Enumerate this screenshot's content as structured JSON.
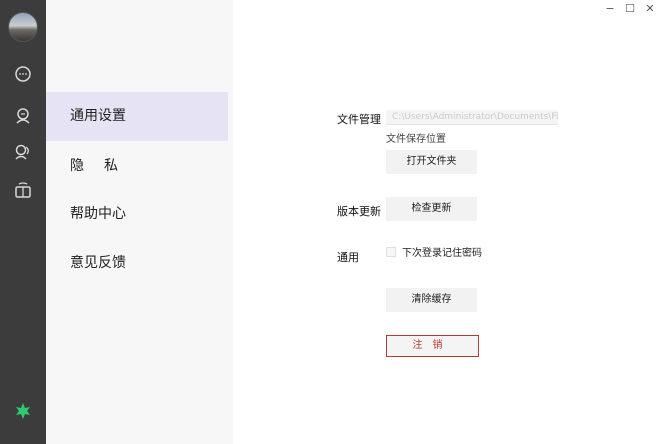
{
  "window": {
    "minimize_label": "−",
    "maximize_label": "☐",
    "close_label": "✕"
  },
  "rail": {
    "icons": [
      "chat-icon",
      "contacts-icon",
      "groups-icon",
      "discover-icon"
    ],
    "bottom_icon": "leaf-icon",
    "accent_color": "#2ecc71"
  },
  "settings_nav": {
    "items": [
      {
        "label": "通用设置",
        "active": true
      },
      {
        "label": "隐私",
        "active": false
      },
      {
        "label": "帮助中心",
        "active": false
      },
      {
        "label": "意见反馈",
        "active": false
      }
    ],
    "active_color": "#e6e4f4"
  },
  "file_management": {
    "label": "文件管理",
    "path_value": "C:\\Users\\Administrator\\Documents\\Files",
    "hint": "文件保存位置",
    "open_folder_button": "打开文件夹"
  },
  "version": {
    "label": "版本更新",
    "check_button": "检查更新"
  },
  "general": {
    "label": "通用",
    "remember_password_label": "下次登录记住密码",
    "clear_cache_button": "清除缓存"
  },
  "logout": {
    "label": "注销",
    "color": "#c0392b"
  }
}
